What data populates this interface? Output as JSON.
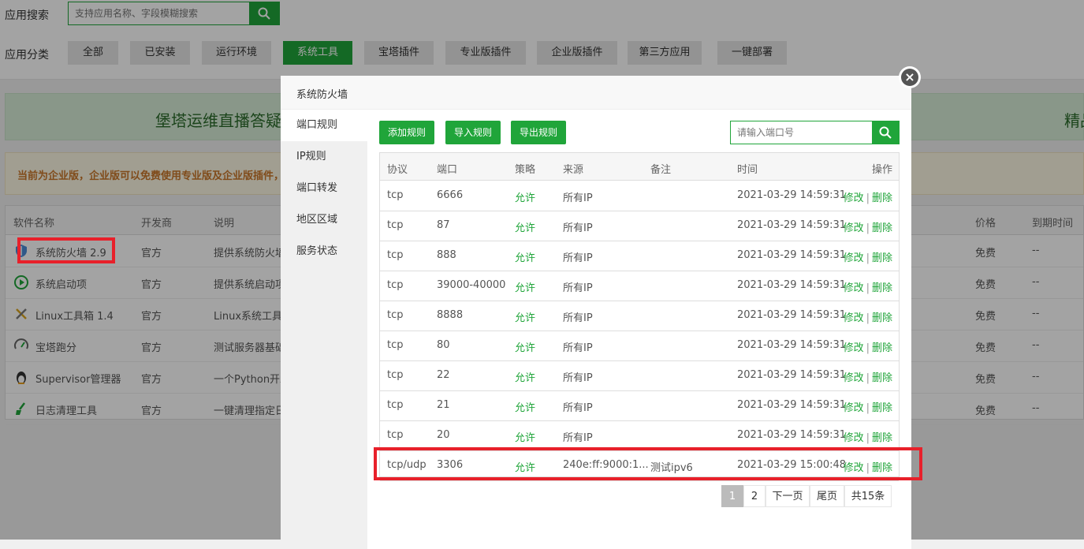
{
  "topbar": {
    "search_label": "应用搜索",
    "search_placeholder": "支持应用名称、字段模糊搜索",
    "category_label": "应用分类",
    "categories": [
      "全部",
      "已安装",
      "运行环境",
      "系统工具",
      "宝塔插件",
      "专业版插件",
      "企业版插件",
      "第三方应用",
      "一键部署"
    ],
    "active_category": "系统工具"
  },
  "banner": {
    "left_text": "堡塔运维直播答疑",
    "right_text": "精品"
  },
  "notice": {
    "text": "当前为企业版，企业版可以免费使用专业版及企业版插件，"
  },
  "software_table": {
    "headers": [
      "软件名称",
      "开发商",
      "说明",
      "价格",
      "到期时间"
    ],
    "rows": [
      {
        "name": "系统防火墙 2.9",
        "dev": "官方",
        "desc": "提供系统防火墙",
        "price": "免费",
        "expire": "--",
        "icon": "shield-icon"
      },
      {
        "name": "系统启动项",
        "dev": "官方",
        "desc": "提供系统启动项",
        "price": "免费",
        "expire": "--",
        "icon": "play-icon"
      },
      {
        "name": "Linux工具箱 1.4",
        "dev": "官方",
        "desc": "Linux系统工具，",
        "price": "免费",
        "expire": "--",
        "icon": "tools-icon"
      },
      {
        "name": "宝塔跑分",
        "dev": "官方",
        "desc": "测试服务器基础",
        "price": "免费",
        "expire": "--",
        "icon": "gauge-icon"
      },
      {
        "name": "Supervisor管理器",
        "dev": "官方",
        "desc": "一个Python开发",
        "price": "免费",
        "expire": "--",
        "icon": "penguin-icon"
      },
      {
        "name": "日志清理工具",
        "dev": "官方",
        "desc": "一键清理指定日",
        "price": "免费",
        "expire": "--",
        "icon": "broom-icon"
      }
    ]
  },
  "modal": {
    "title": "系统防火墙",
    "close_glyph": "×",
    "menu": [
      "端口规则",
      "IP规则",
      "端口转发",
      "地区区域",
      "服务状态"
    ],
    "active_menu": "端口规则",
    "toolbar": {
      "add": "添加规则",
      "import": "导入规则",
      "export": "导出规则",
      "port_placeholder": "请输入端口号"
    },
    "table": {
      "headers": [
        "协议",
        "端口",
        "策略",
        "来源",
        "备注",
        "时间",
        "操作"
      ],
      "edit_label": "修改",
      "separator": "|",
      "delete_label": "删除",
      "rows": [
        {
          "protocol": "tcp",
          "port": "6666",
          "policy": "允许",
          "source": "所有IP",
          "note": "",
          "time": "2021-03-29 14:59:31"
        },
        {
          "protocol": "tcp",
          "port": "87",
          "policy": "允许",
          "source": "所有IP",
          "note": "",
          "time": "2021-03-29 14:59:31"
        },
        {
          "protocol": "tcp",
          "port": "888",
          "policy": "允许",
          "source": "所有IP",
          "note": "",
          "time": "2021-03-29 14:59:31"
        },
        {
          "protocol": "tcp",
          "port": "39000-40000",
          "policy": "允许",
          "source": "所有IP",
          "note": "",
          "time": "2021-03-29 14:59:31"
        },
        {
          "protocol": "tcp",
          "port": "8888",
          "policy": "允许",
          "source": "所有IP",
          "note": "",
          "time": "2021-03-29 14:59:31"
        },
        {
          "protocol": "tcp",
          "port": "80",
          "policy": "允许",
          "source": "所有IP",
          "note": "",
          "time": "2021-03-29 14:59:31"
        },
        {
          "protocol": "tcp",
          "port": "22",
          "policy": "允许",
          "source": "所有IP",
          "note": "",
          "time": "2021-03-29 14:59:31"
        },
        {
          "protocol": "tcp",
          "port": "21",
          "policy": "允许",
          "source": "所有IP",
          "note": "",
          "time": "2021-03-29 14:59:31"
        },
        {
          "protocol": "tcp",
          "port": "20",
          "policy": "允许",
          "source": "所有IP",
          "note": "",
          "time": "2021-03-29 14:59:31"
        },
        {
          "protocol": "tcp/udp",
          "port": "3306",
          "policy": "允许",
          "source": "240e:ff:9000:1...",
          "note": "测试ipv6",
          "time": "2021-03-29 15:00:48"
        }
      ]
    },
    "pagination": {
      "pages": [
        "1",
        "2"
      ],
      "current": "1",
      "next": "下一页",
      "last": "尾页",
      "total": "共15条"
    }
  },
  "colors": {
    "accent": "#20a53a",
    "highlight": "#e8202a"
  }
}
